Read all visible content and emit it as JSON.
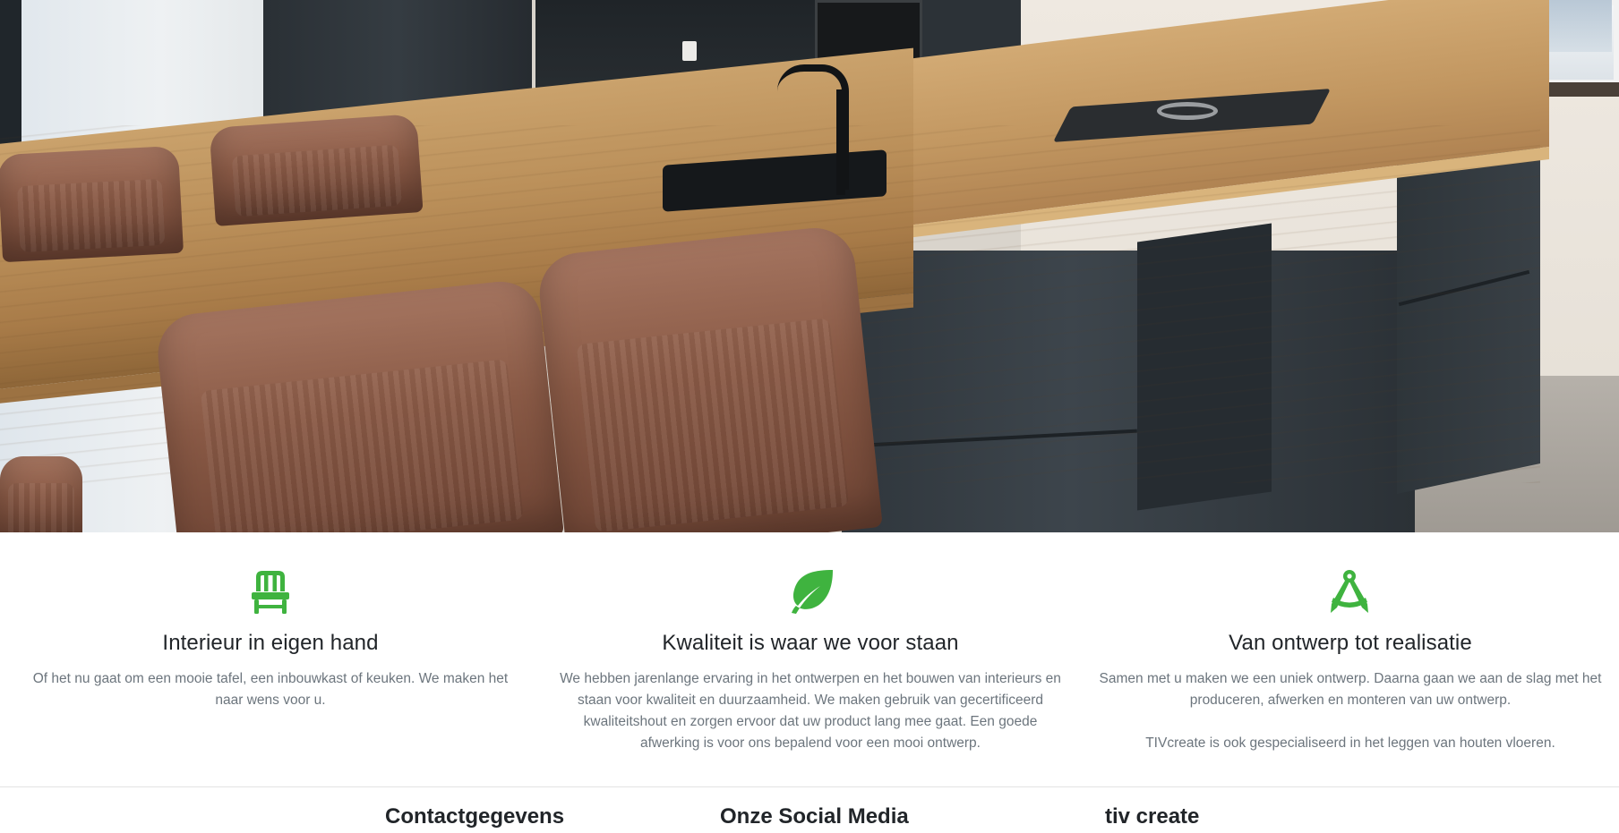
{
  "colors": {
    "accent": "#3fb33f",
    "heading": "#212529",
    "body_text": "#6c757d"
  },
  "hero": {
    "image": "kitchen-island-photo"
  },
  "features": [
    {
      "icon": "chair-icon",
      "title": "Interieur in eigen hand",
      "text": [
        "Of het nu gaat om een mooie tafel, een inbouwkast of keuken. We maken het naar wens voor u."
      ]
    },
    {
      "icon": "leaf-icon",
      "title": "Kwaliteit is waar we voor staan",
      "text": [
        "We hebben jarenlange ervaring in het ontwerpen en het bouwen van interieurs en staan voor kwaliteit en duurzaamheid. We maken gebruik van gecertificeerd kwaliteitshout en zorgen ervoor dat uw product lang mee gaat. Een goede afwerking is voor ons bepalend voor een mooi ontwerp."
      ]
    },
    {
      "icon": "compass-drafting-icon",
      "title": "Van ontwerp tot realisatie",
      "text": [
        "Samen met u maken we een uniek ontwerp. Daarna gaan we aan de slag met het produceren, afwerken en monteren van uw ontwerp.",
        "TIVcreate is ook gespecialiseerd in het leggen van houten vloeren."
      ]
    }
  ],
  "footer": {
    "headings": [
      "Contactgegevens",
      "Onze Social Media",
      "tiv create"
    ]
  }
}
